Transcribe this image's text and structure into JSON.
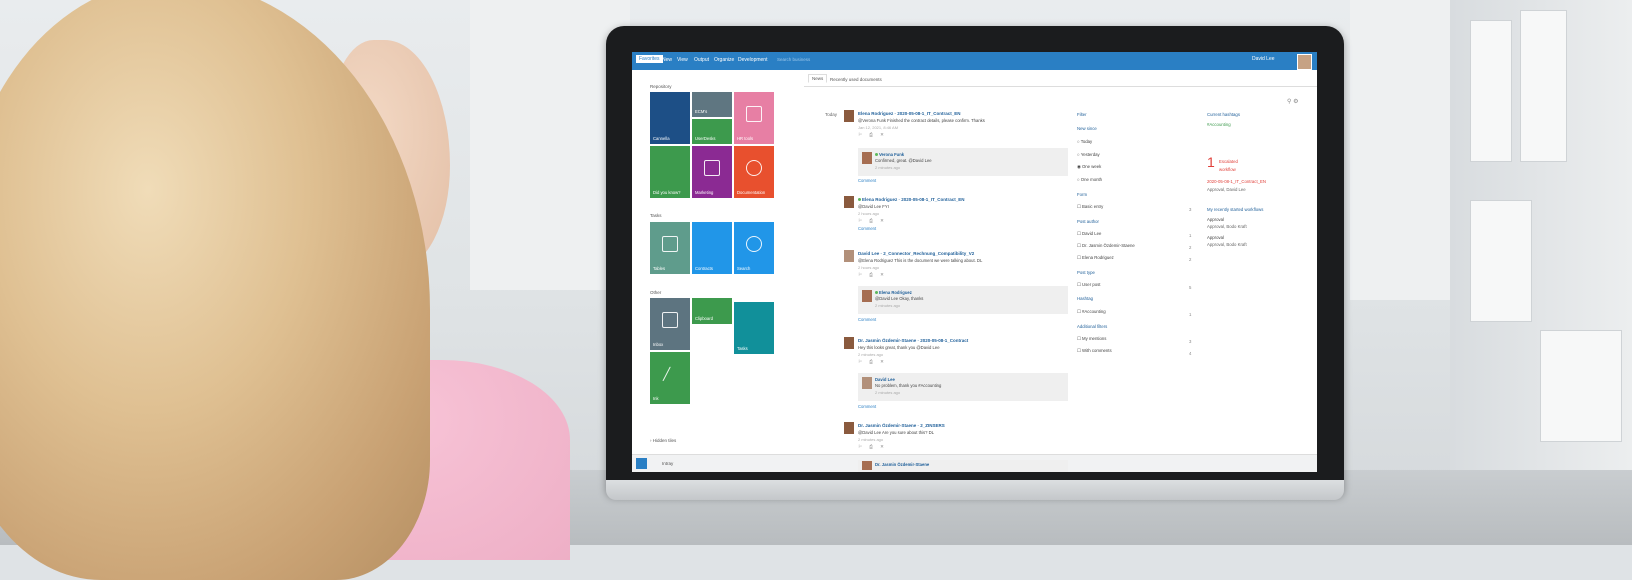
{
  "topbar": {
    "tabs": [
      "Favorites",
      "New",
      "View",
      "Output",
      "Organize",
      "Development"
    ],
    "search_placeholder": "Search business",
    "user_name": "David Lee"
  },
  "left": {
    "sections": {
      "repository": "Repository",
      "tasks": "Tasks",
      "other": "Other"
    },
    "tiles": {
      "cannella": "Cannella",
      "ecm": "ECM's",
      "userdesks": "UserDesks",
      "hr_tools": "HR tools",
      "did_you_know": "Did you know?",
      "marketing": "Marketing",
      "documentation": "Documentation",
      "tables": "Tables",
      "contracts": "Contracts",
      "search": "Search",
      "inbox": "Inbox",
      "clipboard": "Clipboard",
      "tasks": "Tasks",
      "ink": "Ink",
      "elo": "ELO"
    },
    "show_view": "Hidden tiles",
    "colors": {
      "navy": "#1d4f86",
      "gray": "#5f7681",
      "pink": "#e77fa4",
      "green": "#3d9a4d",
      "purple": "#8b2a93",
      "orange": "#e8502e",
      "teal_gray": "#5f9c8c",
      "blue": "#2196e8",
      "teal": "#11909a",
      "slate": "#5d7480"
    }
  },
  "bottombar": {
    "text": "Intray"
  },
  "feed": {
    "tabs": [
      "News",
      "Recently used documents"
    ],
    "today": "Today",
    "posts": [
      {
        "head": "Elena Rodriguez · 2020-05-08-1_IT_Contract_EN",
        "body": "@Verona Funk Finished the contract details, please confirm. Thanks",
        "time": "Jan 12, 2021, 8:46 AM",
        "reply": {
          "name": "Verona Funk",
          "body": "Confirmed, great. @David Lee",
          "time": "2 minutes ago"
        },
        "comment": "Comment"
      },
      {
        "head": "Elena Rodriguez · 2020-05-08-1_IT_Contract_EN",
        "body": "@David Lee FYI",
        "time": "2 hours ago",
        "comment": "Comment"
      },
      {
        "head": "David Lee · 2_Connector_Rechnung_Compatibility_V2",
        "body": "@Elena Rodriguez This is the document we were talking about. DL",
        "time": "2 hours ago",
        "reply": {
          "name": "Elena Rodriguez",
          "body": "@David Lee Okay, thanks",
          "time": "2 minutes ago"
        },
        "comment": "Comment"
      },
      {
        "head": "Dr. Jasmin Özdemir-Staene · 2020-05-08-1_Contract",
        "body": "Hey this looks great, thank you @David Lee",
        "time": "2 minutes ago",
        "reply": {
          "name": "David Lee",
          "body": "No problem, thank you #Accounting",
          "time": "2 minutes ago"
        },
        "comment": "Comment"
      },
      {
        "head": "Dr. Jasmin Özdemir-Staene · 2_ZINSERS",
        "body": "@David Lee Are you sure about this? DL",
        "time": "2 minutes ago",
        "reply": {
          "name": "Dr. Jasmin Özdemir-Staene",
          "body": "",
          "time": ""
        }
      }
    ]
  },
  "filter": {
    "title": "Filter",
    "new_since": "New since",
    "options": [
      "Today",
      "Yesterday",
      "One week",
      "One month"
    ],
    "form": "Form",
    "basic_entry": "Basic entry",
    "basic_entry_count": "3",
    "post_author": "Post author",
    "authors": [
      "David Lee",
      "Dr. Jasmin Özdemir-Staene",
      "Elena Rodriguez"
    ],
    "author_counts": [
      "1",
      "2",
      "2"
    ],
    "post_type": "Post type",
    "user_post": "User post",
    "user_post_count": "5",
    "hashtag": "Hashtag",
    "accounting": "#Accounting",
    "accounting_count": "1",
    "additional_filters": "Additional filters",
    "my_mentions": "My mentions",
    "my_mentions_count": "3",
    "with_comments": "With comments",
    "with_comments_count": "4"
  },
  "right": {
    "current_hashtags": "Current hashtags",
    "hashtag_value": "#Accounting",
    "escalated_count": "1",
    "escalated_label": "Escalated",
    "workflow_label": "workflow",
    "escalated_doc": "2020-05-08-1_IT_Contract_EN",
    "escalated_sub": "Approval, David Lee",
    "recent_workflows": "My recently started workflows",
    "wf": [
      {
        "title": "Approval",
        "sub": "Approval, Bodo Kraft"
      },
      {
        "title": "Approval",
        "sub": "Approval, Bodo Kraft"
      }
    ]
  }
}
